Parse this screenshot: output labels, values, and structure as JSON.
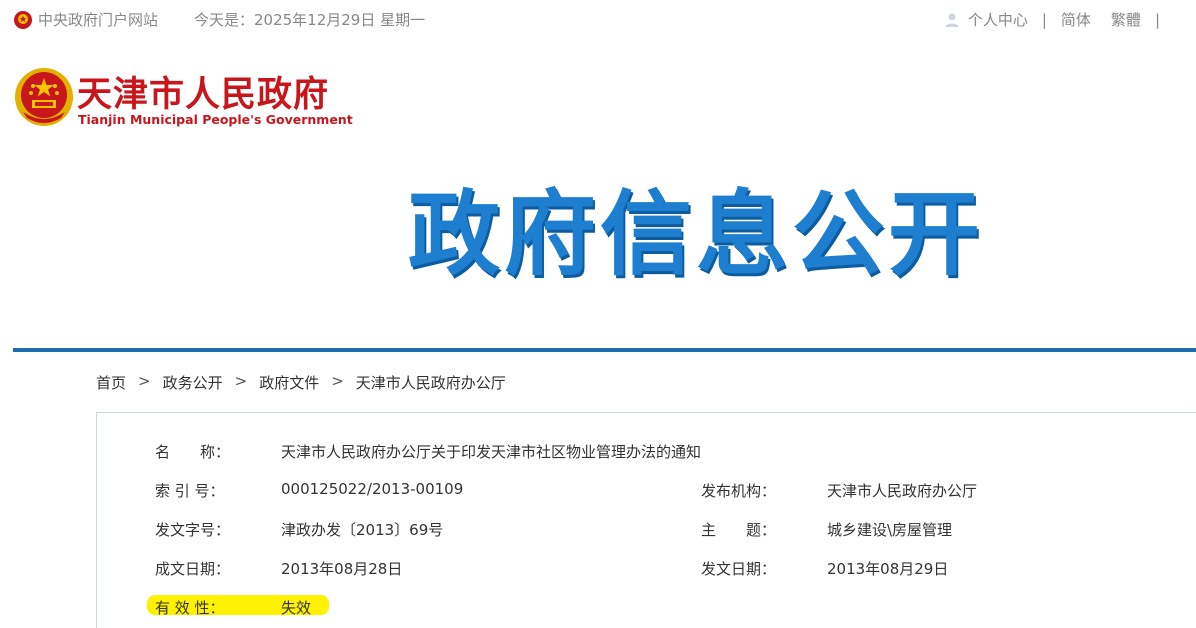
{
  "topbar": {
    "portal_label": "中央政府门户网站",
    "date_label": "今天是：2025年12月29日 星期一",
    "user_center": "个人中心",
    "simplified": "简体",
    "traditional": "繁體",
    "separator": "|"
  },
  "logo": {
    "title_cn": "天津市人民政府",
    "title_en": "Tianjin Municipal People's Government"
  },
  "banner": {
    "text": "政府信息公开"
  },
  "breadcrumb": {
    "items": [
      "首页",
      "政务公开",
      "政府文件",
      "天津市人民政府办公厅"
    ],
    "arrow": ">"
  },
  "document": {
    "name_label": "名　　称：",
    "name_value": "天津市人民政府办公厅关于印发天津市社区物业管理办法的通知",
    "index_label": "索 引 号：",
    "index_value": "000125022/2013-00109",
    "publisher_label": "发布机构：",
    "publisher_value": "天津市人民政府办公厅",
    "docno_label": "发文字号：",
    "docno_value": "津政办发〔2013〕69号",
    "subject_label": "主　　题：",
    "subject_value": "城乡建设\\房屋管理",
    "created_label": "成文日期：",
    "created_value": "2013年08月28日",
    "issued_label": "发文日期：",
    "issued_value": "2013年08月29日",
    "validity_label": "有 效 性：",
    "validity_value": "失效"
  },
  "colors": {
    "brand_red": "#c8161d",
    "banner_blue": "#1e7fd0",
    "rule_blue": "#1f6bb0",
    "highlight": "#fff200"
  }
}
